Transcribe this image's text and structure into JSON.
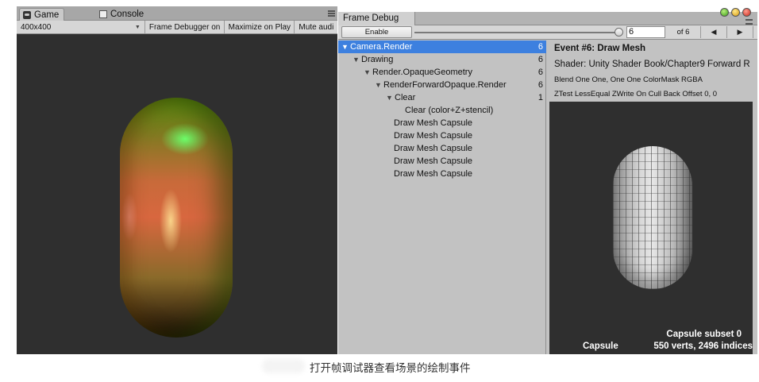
{
  "game": {
    "tabs": [
      {
        "label": "Game",
        "icon": "game-controller-icon"
      },
      {
        "label": "Console",
        "icon": "console-icon"
      }
    ],
    "toolbar": {
      "resolution": "400x400",
      "frame_debugger": "Frame Debugger on",
      "maximize": "Maximize on Play",
      "mute": "Mute audi"
    }
  },
  "frame_debug": {
    "tab_label": "Frame Debug",
    "enable_label": "Enable",
    "event_value": "6",
    "event_total": "of 6",
    "prev_label": "◀",
    "next_label": "▶",
    "tree": [
      {
        "label": "Camera.Render",
        "count": "6"
      },
      {
        "label": "Drawing",
        "count": "6"
      },
      {
        "label": "Render.OpaqueGeometry",
        "count": "6"
      },
      {
        "label": "RenderForwardOpaque.Render",
        "count": "6"
      },
      {
        "label": "Clear",
        "count": "1"
      },
      {
        "label": "Clear (color+Z+stencil)",
        "count": ""
      },
      {
        "label": "Draw Mesh Capsule",
        "count": ""
      },
      {
        "label": "Draw Mesh Capsule",
        "count": ""
      },
      {
        "label": "Draw Mesh Capsule",
        "count": ""
      },
      {
        "label": "Draw Mesh Capsule",
        "count": ""
      },
      {
        "label": "Draw Mesh Capsule",
        "count": ""
      }
    ],
    "detail": {
      "title": "Event #6: Draw Mesh",
      "shader": "Shader: Unity Shader Book/Chapter9 Forward R",
      "blend": "Blend One One, One One ColorMask RGBA",
      "ztest": "ZTest LessEqual ZWrite On Cull Back Offset 0, 0",
      "preview_subset": "Capsule subset 0",
      "preview_name": "Capsule",
      "preview_stats": "550 verts, 2496 indices"
    }
  },
  "caption": "打开帧调试器查看场景的绘制事件",
  "colors": {
    "selection": "#3d80df",
    "panel": "#c2c2c2",
    "viewport": "#2f2f2f"
  }
}
